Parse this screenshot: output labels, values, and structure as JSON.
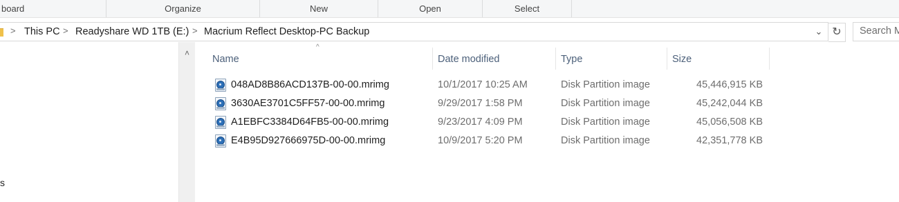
{
  "ribbon": {
    "groups": [
      "board",
      "Organize",
      "New",
      "Open",
      "Select"
    ]
  },
  "address_bar": {
    "breadcrumbs": [
      "This PC",
      "Readyshare WD 1TB (E:)",
      "Macrium Reflect Desktop-PC Backup"
    ],
    "separator": ">",
    "dropdown_glyph": "⌄",
    "refresh_glyph": "↻"
  },
  "search": {
    "placeholder": "Search M"
  },
  "nav_pane": {
    "visible_fragment": "s"
  },
  "file_list": {
    "sort_glyph": "^",
    "columns": [
      "Name",
      "Date modified",
      "Type",
      "Size"
    ],
    "rows": [
      {
        "name": "048AD8B86ACD137B-00-00.mrimg",
        "date": "10/1/2017 10:25 AM",
        "type": "Disk Partition image",
        "size": "45,446,915 KB"
      },
      {
        "name": "3630AE3701C5FF57-00-00.mrimg",
        "date": "9/29/2017 1:58 PM",
        "type": "Disk Partition image",
        "size": "45,242,044 KB"
      },
      {
        "name": "A1EBFC3384D64FB5-00-00.mrimg",
        "date": "9/23/2017 4:09 PM",
        "type": "Disk Partition image",
        "size": "45,056,508 KB"
      },
      {
        "name": "E4B95D927666975D-00-00.mrimg",
        "date": "10/9/2017 5:20 PM",
        "type": "Disk Partition image",
        "size": "42,351,778 KB"
      }
    ],
    "icon": "disk-image-file-icon"
  },
  "colors": {
    "header_text": "#4c607a",
    "folder": "#f0c14b",
    "disk_icon": "#2c6fb7"
  }
}
